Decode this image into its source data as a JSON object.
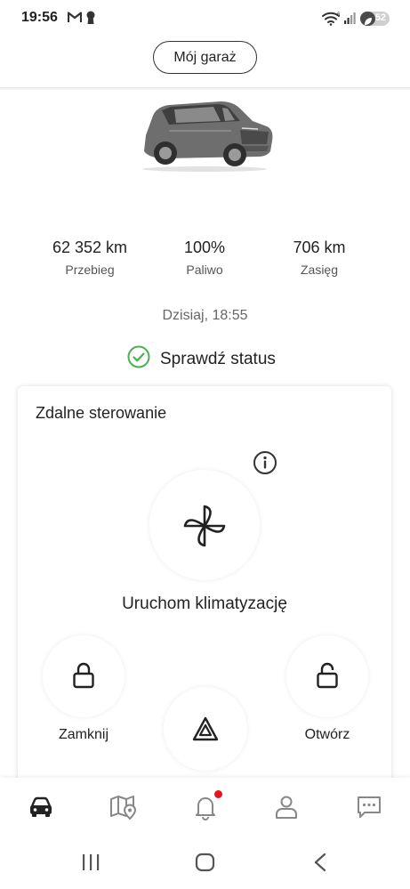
{
  "status_bar": {
    "time": "19:56",
    "battery_level": "52",
    "icons": [
      "gmail-icon",
      "keyhole-icon",
      "wifi-icon",
      "signal-icon",
      "battery-saver-icon"
    ]
  },
  "header": {
    "garage_button": "Mój garaż"
  },
  "vehicle": {
    "image": "car-image",
    "stats": [
      {
        "value": "62 352 km",
        "label": "Przebieg"
      },
      {
        "value": "100%",
        "label": "Paliwo"
      },
      {
        "value": "706 km",
        "label": "Zasięg"
      }
    ],
    "updated": "Dzisiaj, 18:55",
    "status_link": "Sprawdź status"
  },
  "remote": {
    "title": "Zdalne sterowanie",
    "climate_label": "Uruchom klimatyzację",
    "lock_label": "Zamknij",
    "unlock_label": "Otwórz"
  },
  "bottom_nav": {
    "items": [
      "car-icon",
      "map-pin-icon",
      "bell-icon",
      "profile-icon",
      "chat-icon"
    ],
    "notification_badge": true
  },
  "colors": {
    "accent_green": "#4caf50",
    "badge_red": "#e5141e",
    "text": "#222222",
    "muted": "#666666"
  }
}
